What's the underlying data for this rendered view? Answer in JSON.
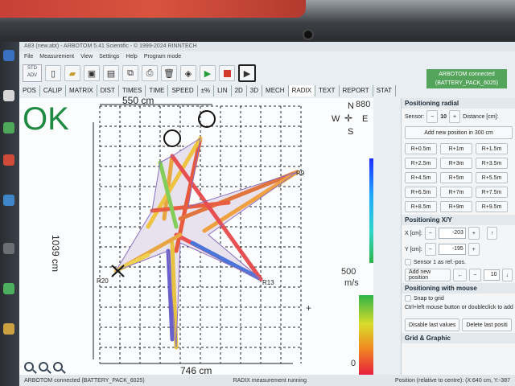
{
  "window": {
    "title": "A83 (new.abt) - ARBOTOM 5.41 Scientific - © 1999-2024 RINNTECH"
  },
  "menu": [
    "File",
    "Measurement",
    "View",
    "Settings",
    "Help",
    "Program mode"
  ],
  "toolbar": {
    "std_label": "STD",
    "adv_label": "ADV",
    "play_label": "▶",
    "abt_label": "ABT"
  },
  "connection_badge": {
    "line1": "ARBOTOM connected",
    "line2": "(BATTERY_PACK_6025)"
  },
  "tabs": [
    "POS",
    "CALIP",
    "MATRIX",
    "DIST",
    "TIMES",
    "TIME",
    "SPEED",
    "±%",
    "LIN",
    "2D",
    "3D",
    "MECH",
    "RADIX",
    "TEXT",
    "REPORT",
    "STAT"
  ],
  "plot": {
    "status": "OK",
    "width_label": "550 cm",
    "height_label": "1039 cm",
    "bottom_label": "746 cm",
    "scale_top": "880",
    "scale_mid": "500",
    "scale_unit": "m/s",
    "scale_bottom": "0",
    "compass": {
      "n": "N",
      "s": "S",
      "e": "E",
      "w": "W"
    },
    "sensor_labels": {
      "r20": "R20",
      "r13": "R13",
      "r9": "R9"
    }
  },
  "positioning_radial": {
    "title": "Positioning radial",
    "sensor_label": "Sensor:",
    "sensor_value": "10",
    "distance_label": "Distance [cm]:",
    "add_button": "Add new position in 300 cm",
    "r_buttons": [
      "R+0.5m",
      "R+1m",
      "R+1.5m",
      "R+2.5m",
      "R+3m",
      "R+3.5m",
      "R+4.5m",
      "R+5m",
      "R+5.5m",
      "R+6.5m",
      "R+7m",
      "R+7.5m",
      "R+8.5m",
      "R+9m",
      "R+9.5m"
    ]
  },
  "positioning_xy": {
    "title": "Positioning X/Y",
    "x_label": "X [cm]:",
    "x_value": "-203",
    "y_label": "Y [cm]:",
    "y_value": "-195",
    "sensor1_label": "Sensor 1 as ref.-pos.",
    "add_button": "Add new position",
    "step_value": "10"
  },
  "positioning_mouse": {
    "title": "Positioning with mouse",
    "snap_label": "Snap to grid",
    "hint": "Ctrl+left mouse button or doubleclick to add p"
  },
  "bottom_buttons": {
    "disable": "Disable last values",
    "delete": "Delete last positi"
  },
  "grid_graphic_title": "Grid & Graphic",
  "statusbar": {
    "left": "ARBOTOM connected (BATTERY_PACK_6025)",
    "middle": "RADIX measurement running",
    "right": "Position (relative to centre): (X:640 cm, Y:-387"
  }
}
